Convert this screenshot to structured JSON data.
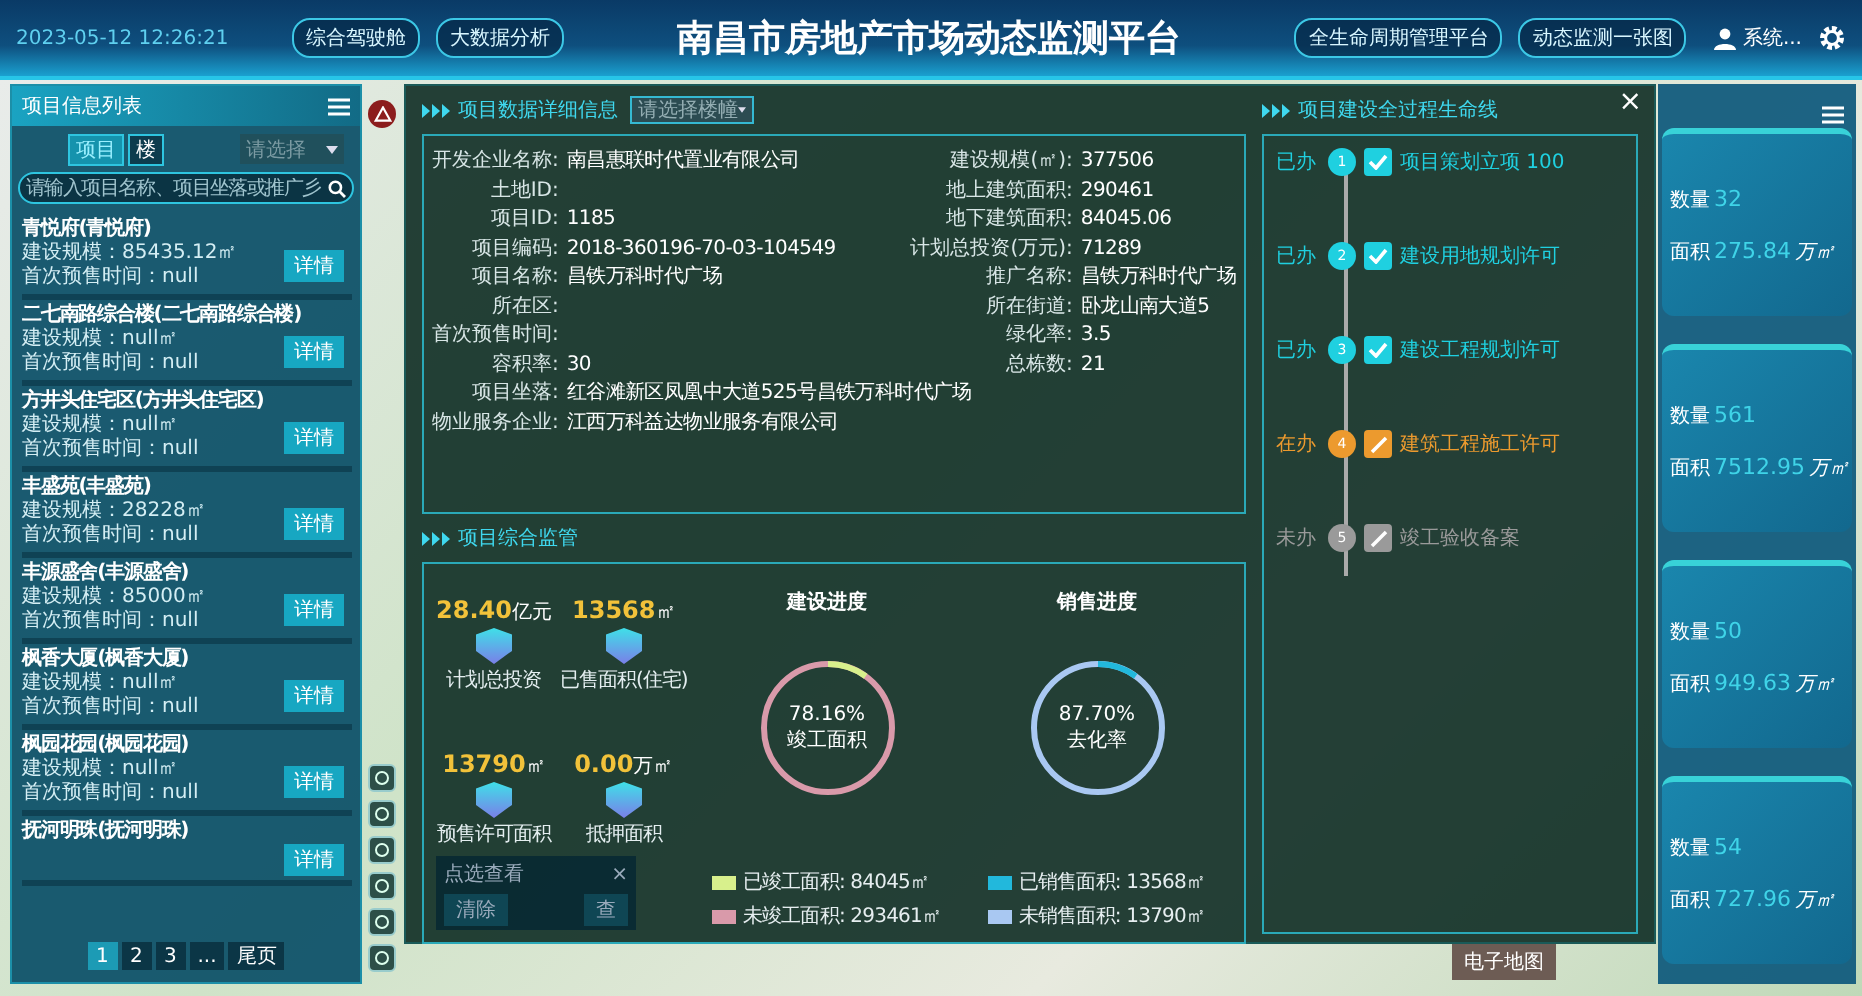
{
  "header": {
    "datetime": "2023-05-12  12:26:21",
    "nav_left": [
      "综合驾驶舱",
      "大数据分析"
    ],
    "title": "南昌市房地产市场动态监测平台",
    "nav_right": [
      "全生命周期管理平台",
      "动态监测一张图"
    ],
    "user": "系统..."
  },
  "project_panel": {
    "title": "项目信息列表",
    "tabs": [
      {
        "label": "项目",
        "selected": true
      },
      {
        "label": "楼",
        "selected": false
      }
    ],
    "select": {
      "placeholder": "请选择"
    },
    "search": {
      "placeholder": "请输入项目名称、项目坐落或推广彡"
    },
    "projects": [
      {
        "name": "青悦府(青悦府)",
        "scale": "建设规模：85435.12㎡",
        "presale": "首次预售时间：null",
        "button": "详情"
      },
      {
        "name": "二七南路综合楼(二七南路综合楼)",
        "scale": "建设规模：null㎡",
        "presale": "首次预售时间：null",
        "button": "详情"
      },
      {
        "name": "方井头住宅区(方井头住宅区)",
        "scale": "建设规模：null㎡",
        "presale": "首次预售时间：null",
        "button": "详情"
      },
      {
        "name": "丰盛苑(丰盛苑)",
        "scale": "建设规模：28228㎡",
        "presale": "首次预售时间：null",
        "button": "详情"
      },
      {
        "name": "丰源盛舍(丰源盛舍)",
        "scale": "建设规模：85000㎡",
        "presale": "首次预售时间：null",
        "button": "详情"
      },
      {
        "name": "枫香大厦(枫香大厦)",
        "scale": "建设规模：null㎡",
        "presale": "首次预售时间：null",
        "button": "详情"
      },
      {
        "name": "枫园花园(枫园花园)",
        "scale": "建设规模：null㎡",
        "presale": "首次预售时间：null",
        "button": "详情"
      },
      {
        "name": "抚河明珠(抚河明珠)",
        "button": "详情"
      }
    ],
    "pagination": [
      {
        "label": "1",
        "selected": true
      },
      {
        "label": "2",
        "selected": false
      },
      {
        "label": "3",
        "selected": false
      },
      {
        "label": "...",
        "selected": false
      },
      {
        "label": "尾页",
        "selected": false
      }
    ]
  },
  "map": {
    "map_type_button": "电子地图"
  },
  "detail_modal": {
    "close": "×",
    "detail": {
      "title": "项目数据详细信息",
      "select": {
        "placeholder": "请选择楼幢"
      },
      "fields_left": [
        {
          "label": "开发企业名称:",
          "value": "南昌惠联时代置业有限公司"
        },
        {
          "label": "土地ID:"
        },
        {
          "label": "项目ID:",
          "value": "1185"
        },
        {
          "label": "项目编码:",
          "value": "2018-360196-70-03-104549"
        },
        {
          "label": "项目名称:",
          "value": "昌铁万科时代广场"
        },
        {
          "label": "所在区:"
        },
        {
          "label": "首次预售时间:"
        },
        {
          "label": "容积率:",
          "value": "30"
        },
        {
          "label": "项目坐落:",
          "value": "红谷滩新区凤凰中大道525号昌铁万科时代广场"
        },
        {
          "label": "物业服务企业:",
          "value": "江西万科益达物业服务有限公司"
        }
      ],
      "fields_right": [
        {
          "label": "建设规模(㎡):",
          "value": "377506"
        },
        {
          "label": "地上建筑面积:",
          "value": "290461"
        },
        {
          "label": "地下建筑面积:",
          "value": "84045.06"
        },
        {
          "label": "计划总投资(万元):",
          "value": "71289"
        },
        {
          "label": "推广名称:",
          "value": "昌铁万科时代广场"
        },
        {
          "label": "所在街道:",
          "value": "卧龙山南大道5"
        },
        {
          "label": "绿化率:",
          "value": "3.5"
        },
        {
          "label": "总栋数:",
          "value": "21"
        }
      ]
    },
    "monitoring": {
      "title": "项目综合监管",
      "stats": [
        {
          "value": "28.40",
          "unit": "亿元",
          "label": "计划总投资"
        },
        {
          "value": "13568",
          "unit": "㎡",
          "label": "已售面积(住宅)"
        },
        {
          "value": "13790",
          "unit": "㎡",
          "label": "预售许可面积"
        },
        {
          "value": "0.00",
          "unit": "万㎡",
          "label": "抵押面积"
        }
      ],
      "progress": [
        {
          "title": "建设进度",
          "value": "78.16%",
          "caption": "竣工面积",
          "legend": [
            {
              "label": "已竣工面积: 84045㎡",
              "color": "#d8f08c"
            },
            {
              "label": "未竣工面积: 293461㎡",
              "color": "#d99aaa"
            }
          ]
        },
        {
          "title": "销售进度",
          "value": "87.70%",
          "caption": "去化率",
          "legend": [
            {
              "label": "已销售面积: 13568㎡",
              "color": "#22b8dc"
            },
            {
              "label": "未销售面积: 13790㎡",
              "color": "#a9c8f2"
            }
          ]
        }
      ],
      "popup": {
        "title": "点选查看",
        "close": "×",
        "buttons": [
          "清除",
          "查"
        ]
      }
    },
    "lifecycle": {
      "title": "项目建设全过程生命线",
      "steps": [
        {
          "status_label": "已办",
          "number": "1",
          "title": "项目策划立项  100",
          "kind": "done"
        },
        {
          "status_label": "已办",
          "number": "2",
          "title": "建设用地规划许可",
          "kind": "done"
        },
        {
          "status_label": "已办",
          "number": "3",
          "title": "建设工程规划许可",
          "kind": "done"
        },
        {
          "status_label": "在办",
          "number": "4",
          "title": "建筑工程施工许可",
          "kind": "doing"
        },
        {
          "status_label": "未办",
          "number": "5",
          "title": "竣工验收备案",
          "kind": "todo"
        }
      ]
    }
  },
  "stats_panel": {
    "cards": [
      {
        "count_label": "数量",
        "count": "32",
        "area_label": "面积",
        "area": "275.84",
        "unit": "万㎡"
      },
      {
        "count_label": "数量",
        "count": "561",
        "area_label": "面积",
        "area": "7512.95",
        "unit": "万㎡"
      },
      {
        "count_label": "数量",
        "count": "50",
        "area_label": "面积",
        "area": "949.63",
        "unit": "万㎡"
      },
      {
        "count_label": "数量",
        "count": "54",
        "area_label": "面积",
        "area": "727.96",
        "unit": "万㎡"
      }
    ]
  }
}
